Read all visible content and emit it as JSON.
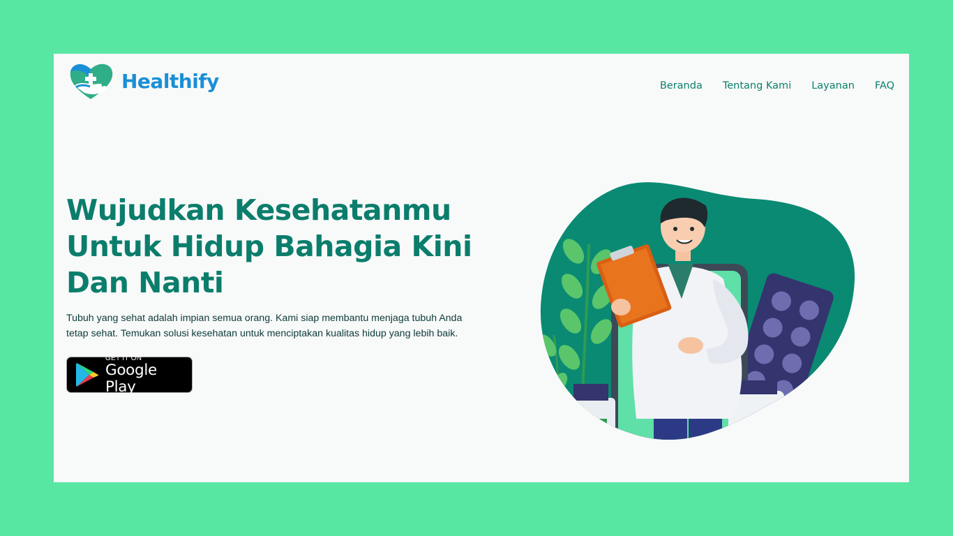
{
  "brand": {
    "name": "Healthify",
    "logo_icon": "heart-hand-cross-icon"
  },
  "nav": {
    "items": [
      {
        "label": "Beranda"
      },
      {
        "label": "Tentang Kami"
      },
      {
        "label": "Layanan"
      },
      {
        "label": "FAQ"
      }
    ]
  },
  "hero": {
    "title_line1": "Wujudkan Kesehatanmu",
    "title_line2": "Untuk Hidup Bahagia Kini",
    "title_line3": "Dan Nanti",
    "description": "Tubuh yang sehat adalah impian semua orang. Kami siap membantu menjaga tubuh Anda tetap sehat. Temukan solusi kesehatan untuk menciptakan kualitas hidup yang lebih baik.",
    "store_button": {
      "small_text": "GET IT ON",
      "big_text": "Google Play",
      "icon": "google-play-icon"
    },
    "illustration": "doctor-with-clipboard-illustration"
  },
  "colors": {
    "background": "#58e6a3",
    "page": "#f8f9f9",
    "primary": "#0b7d6c",
    "brand_blue": "#1a8fd6"
  }
}
